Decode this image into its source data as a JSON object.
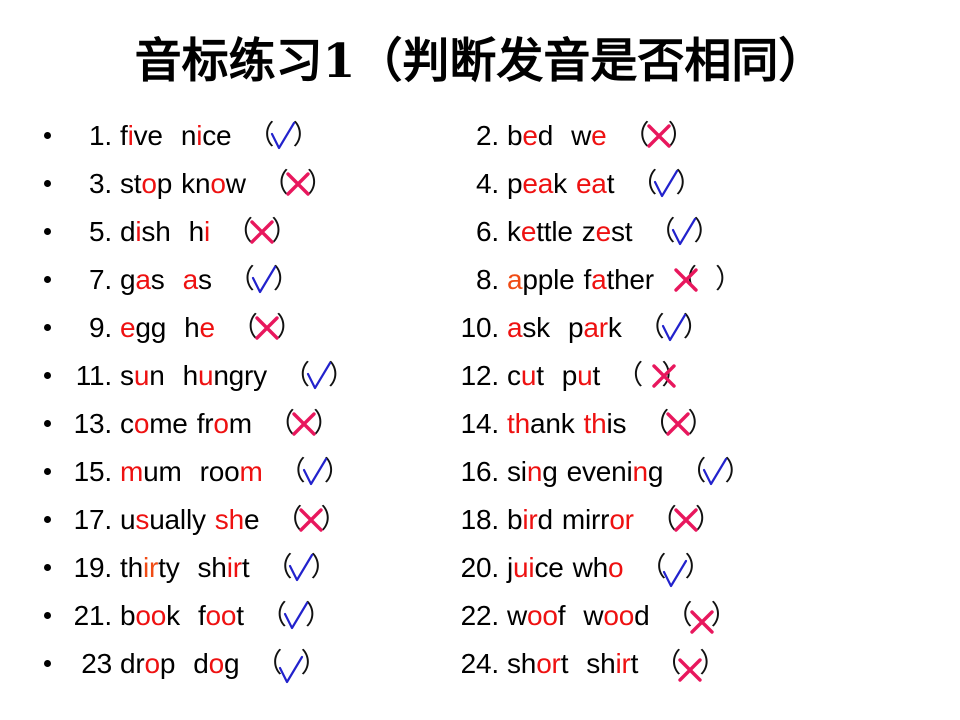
{
  "slide": {
    "title": "音标练习1（判断发音是否相同）",
    "bullet_glyph": "•",
    "colors": {
      "highlight_red": "#ee1111",
      "highlight_orange": "#f04b14",
      "check_blue": "#2222cc",
      "cross_magenta": "#e8175d",
      "text_black": "#000000",
      "background": "#ffffff"
    },
    "answer_marks": {
      "correct": "√",
      "incorrect": "✗"
    }
  },
  "rows": [
    {
      "left": {
        "index": "1.",
        "segments": [
          {
            "t": "f",
            "c": "blk"
          },
          {
            "t": "i",
            "c": "red"
          },
          {
            "t": "ve",
            "c": "blk"
          },
          {
            "t": "  ",
            "c": "gap"
          },
          {
            "t": "n",
            "c": "blk"
          },
          {
            "t": "i",
            "c": "red"
          },
          {
            "t": "ce",
            "c": "blk"
          }
        ],
        "answer": "correct",
        "mark_style": "normal"
      },
      "right": {
        "index": "2.",
        "segments": [
          {
            "t": "b",
            "c": "blk"
          },
          {
            "t": "e",
            "c": "red"
          },
          {
            "t": "d",
            "c": "blk"
          },
          {
            "t": "  ",
            "c": "gap"
          },
          {
            "t": "w",
            "c": "blk"
          },
          {
            "t": "e",
            "c": "red"
          }
        ],
        "answer": "incorrect",
        "mark_style": "normal"
      }
    },
    {
      "left": {
        "index": "3.",
        "segments": [
          {
            "t": "st",
            "c": "blk"
          },
          {
            "t": "o",
            "c": "red"
          },
          {
            "t": "p",
            "c": "blk"
          },
          {
            "t": " ",
            "c": "gap"
          },
          {
            "t": "kn",
            "c": "blk"
          },
          {
            "t": "o",
            "c": "red"
          },
          {
            "t": "w",
            "c": "blk"
          }
        ],
        "answer": "incorrect",
        "mark_style": "normal"
      },
      "right": {
        "index": "4.",
        "segments": [
          {
            "t": "p",
            "c": "blk"
          },
          {
            "t": "ea",
            "c": "red"
          },
          {
            "t": "k",
            "c": "blk"
          },
          {
            "t": " ",
            "c": "gap"
          },
          {
            "t": "ea",
            "c": "red"
          },
          {
            "t": "t",
            "c": "blk"
          }
        ],
        "answer": "correct",
        "mark_style": "normal"
      }
    },
    {
      "left": {
        "index": "5.",
        "segments": [
          {
            "t": "d",
            "c": "blk"
          },
          {
            "t": "i",
            "c": "red"
          },
          {
            "t": "sh",
            "c": "blk"
          },
          {
            "t": "  ",
            "c": "gap"
          },
          {
            "t": "h",
            "c": "blk"
          },
          {
            "t": "i",
            "c": "red"
          }
        ],
        "answer": "incorrect",
        "mark_style": "normal"
      },
      "right": {
        "index": "6.",
        "segments": [
          {
            "t": "k",
            "c": "blk"
          },
          {
            "t": "e",
            "c": "red"
          },
          {
            "t": "ttle",
            "c": "blk"
          },
          {
            "t": " ",
            "c": "gap"
          },
          {
            "t": "z",
            "c": "blk"
          },
          {
            "t": "e",
            "c": "red"
          },
          {
            "t": "st",
            "c": "blk"
          }
        ],
        "answer": "correct",
        "mark_style": "normal"
      }
    },
    {
      "left": {
        "index": "7.",
        "segments": [
          {
            "t": "g",
            "c": "blk"
          },
          {
            "t": "a",
            "c": "red"
          },
          {
            "t": "s",
            "c": "blk"
          },
          {
            "t": "  ",
            "c": "gap"
          },
          {
            "t": "a",
            "c": "red"
          },
          {
            "t": "s",
            "c": "blk"
          }
        ],
        "answer": "correct",
        "mark_style": "normal"
      },
      "right": {
        "index": "8.",
        "segments": [
          {
            "t": "a",
            "c": "orange"
          },
          {
            "t": "pple",
            "c": "blk"
          },
          {
            "t": " ",
            "c": "gap"
          },
          {
            "t": "f",
            "c": "blk"
          },
          {
            "t": "a",
            "c": "red"
          },
          {
            "t": "ther",
            "c": "blk"
          }
        ],
        "answer": "incorrect",
        "mark_style": "over-left-paren"
      }
    },
    {
      "left": {
        "index": "9.",
        "segments": [
          {
            "t": "e",
            "c": "red"
          },
          {
            "t": "gg",
            "c": "blk"
          },
          {
            "t": "  ",
            "c": "gap"
          },
          {
            "t": "h",
            "c": "blk"
          },
          {
            "t": "e",
            "c": "red"
          }
        ],
        "answer": "incorrect",
        "mark_style": "normal"
      },
      "right": {
        "index": "10.",
        "segments": [
          {
            "t": "a",
            "c": "red"
          },
          {
            "t": "sk",
            "c": "blk"
          },
          {
            "t": "  ",
            "c": "gap"
          },
          {
            "t": "p",
            "c": "blk"
          },
          {
            "t": "ar",
            "c": "red"
          },
          {
            "t": "k",
            "c": "blk"
          }
        ],
        "answer": "correct",
        "mark_style": "normal"
      }
    },
    {
      "left": {
        "index": "11.",
        "segments": [
          {
            "t": "s",
            "c": "blk"
          },
          {
            "t": "u",
            "c": "red"
          },
          {
            "t": "n",
            "c": "blk"
          },
          {
            "t": "  ",
            "c": "gap"
          },
          {
            "t": "h",
            "c": "blk"
          },
          {
            "t": "u",
            "c": "red"
          },
          {
            "t": "ngry",
            "c": "blk"
          }
        ],
        "answer": "correct",
        "mark_style": "normal"
      },
      "right": {
        "index": "12.",
        "segments": [
          {
            "t": "c",
            "c": "blk"
          },
          {
            "t": "u",
            "c": "red"
          },
          {
            "t": "t",
            "c": "blk"
          },
          {
            "t": "  ",
            "c": "gap"
          },
          {
            "t": "p",
            "c": "blk"
          },
          {
            "t": "u",
            "c": "red"
          },
          {
            "t": "t",
            "c": "blk"
          }
        ],
        "answer": "incorrect",
        "mark_style": "over-right-paren"
      }
    },
    {
      "left": {
        "index": "13.",
        "segments": [
          {
            "t": "c",
            "c": "blk"
          },
          {
            "t": "o",
            "c": "red"
          },
          {
            "t": "me",
            "c": "blk"
          },
          {
            "t": " ",
            "c": "gap"
          },
          {
            "t": "fr",
            "c": "blk"
          },
          {
            "t": "o",
            "c": "red"
          },
          {
            "t": "m",
            "c": "blk"
          }
        ],
        "answer": "incorrect",
        "mark_style": "normal"
      },
      "right": {
        "index": "14.",
        "segments": [
          {
            "t": "th",
            "c": "red"
          },
          {
            "t": "ank",
            "c": "blk"
          },
          {
            "t": " ",
            "c": "gap"
          },
          {
            "t": "th",
            "c": "red"
          },
          {
            "t": "is",
            "c": "blk"
          }
        ],
        "answer": "incorrect",
        "mark_style": "normal"
      }
    },
    {
      "left": {
        "index": "15.",
        "segments": [
          {
            "t": "m",
            "c": "red"
          },
          {
            "t": "um",
            "c": "blk"
          },
          {
            "t": "  ",
            "c": "gap"
          },
          {
            "t": "roo",
            "c": "blk"
          },
          {
            "t": "m",
            "c": "red"
          }
        ],
        "answer": "correct",
        "mark_style": "normal"
      },
      "right": {
        "index": "16.",
        "segments": [
          {
            "t": "si",
            "c": "blk"
          },
          {
            "t": "n",
            "c": "red"
          },
          {
            "t": "g",
            "c": "blk"
          },
          {
            "t": " ",
            "c": "gap"
          },
          {
            "t": "eveni",
            "c": "blk"
          },
          {
            "t": "n",
            "c": "red"
          },
          {
            "t": "g",
            "c": "blk"
          }
        ],
        "answer": "correct",
        "mark_style": "normal"
      }
    },
    {
      "left": {
        "index": "17.",
        "segments": [
          {
            "t": "u",
            "c": "blk"
          },
          {
            "t": "s",
            "c": "red"
          },
          {
            "t": "ually",
            "c": "blk"
          },
          {
            "t": " ",
            "c": "gap"
          },
          {
            "t": "sh",
            "c": "red"
          },
          {
            "t": "e",
            "c": "blk"
          }
        ],
        "answer": "incorrect",
        "mark_style": "normal"
      },
      "right": {
        "index": "18.",
        "segments": [
          {
            "t": "b",
            "c": "blk"
          },
          {
            "t": "ir",
            "c": "red"
          },
          {
            "t": "d",
            "c": "blk"
          },
          {
            "t": " ",
            "c": "gap"
          },
          {
            "t": "mirr",
            "c": "blk"
          },
          {
            "t": "or",
            "c": "red"
          }
        ],
        "answer": "incorrect",
        "mark_style": "normal"
      }
    },
    {
      "left": {
        "index": "19.",
        "segments": [
          {
            "t": "th",
            "c": "blk"
          },
          {
            "t": "ir",
            "c": "orange"
          },
          {
            "t": "ty",
            "c": "blk"
          },
          {
            "t": "  ",
            "c": "gap"
          },
          {
            "t": "sh",
            "c": "blk"
          },
          {
            "t": "ir",
            "c": "red"
          },
          {
            "t": "t",
            "c": "blk"
          }
        ],
        "answer": "correct",
        "mark_style": "normal"
      },
      "right": {
        "index": "20.",
        "segments": [
          {
            "t": "j",
            "c": "blk"
          },
          {
            "t": "ui",
            "c": "red"
          },
          {
            "t": "ce",
            "c": "blk"
          },
          {
            "t": " ",
            "c": "gap"
          },
          {
            "t": "wh",
            "c": "blk"
          },
          {
            "t": "o",
            "c": "red"
          }
        ],
        "answer": "correct",
        "mark_style": "shift-down"
      }
    },
    {
      "left": {
        "index": "21.",
        "segments": [
          {
            "t": "b",
            "c": "blk"
          },
          {
            "t": "oo",
            "c": "red"
          },
          {
            "t": "k",
            "c": "blk"
          },
          {
            "t": "  ",
            "c": "gap"
          },
          {
            "t": "f",
            "c": "blk"
          },
          {
            "t": "oo",
            "c": "red"
          },
          {
            "t": "t",
            "c": "blk"
          }
        ],
        "answer": "correct",
        "mark_style": "normal"
      },
      "right": {
        "index": "22.",
        "segments": [
          {
            "t": "w",
            "c": "blk"
          },
          {
            "t": "oo",
            "c": "red"
          },
          {
            "t": "f",
            "c": "blk"
          },
          {
            "t": "  ",
            "c": "gap"
          },
          {
            "t": "w",
            "c": "blk"
          },
          {
            "t": "oo",
            "c": "red"
          },
          {
            "t": "d",
            "c": "blk"
          }
        ],
        "answer": "incorrect",
        "mark_style": "shift-down"
      }
    },
    {
      "left": {
        "index": "23",
        "segments": [
          {
            "t": "dr",
            "c": "blk"
          },
          {
            "t": "o",
            "c": "red"
          },
          {
            "t": "p",
            "c": "blk"
          },
          {
            "t": "  ",
            "c": "gap"
          },
          {
            "t": "d",
            "c": "blk"
          },
          {
            "t": "o",
            "c": "red"
          },
          {
            "t": "g",
            "c": "blk"
          }
        ],
        "answer": "correct",
        "mark_style": "shift-down"
      },
      "right": {
        "index": "24.",
        "segments": [
          {
            "t": "sh",
            "c": "blk"
          },
          {
            "t": "or",
            "c": "red"
          },
          {
            "t": "t",
            "c": "blk"
          },
          {
            "t": "  ",
            "c": "gap"
          },
          {
            "t": "sh",
            "c": "blk"
          },
          {
            "t": "ir",
            "c": "red"
          },
          {
            "t": "t",
            "c": "blk"
          }
        ],
        "answer": "incorrect",
        "mark_style": "shift-down"
      }
    }
  ]
}
